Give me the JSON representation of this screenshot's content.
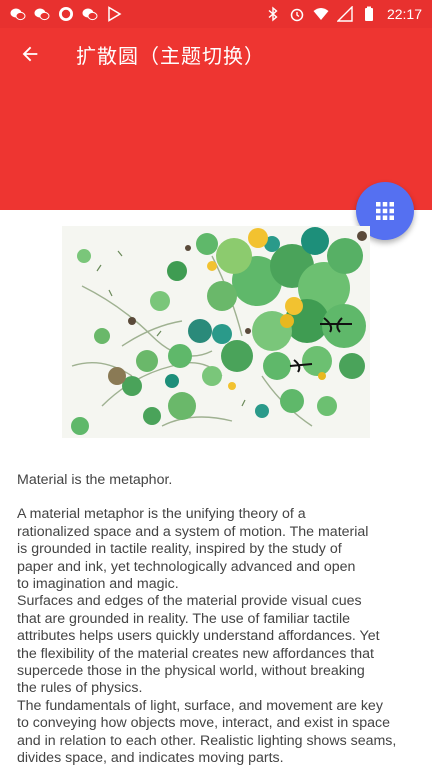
{
  "status_bar": {
    "left_icons": [
      "wechat-icon",
      "wechat-icon",
      "record-icon",
      "wechat-icon",
      "play-store-icon"
    ],
    "right_icons": [
      "bluetooth-icon",
      "alarm-icon",
      "wifi-icon",
      "signal-icon",
      "battery-icon"
    ],
    "time": "22:17"
  },
  "app_bar": {
    "title": "扩散圆（主题切换）",
    "back_icon": "arrow-back-icon",
    "color": "#ee3531"
  },
  "fab": {
    "icon": "grid-icon",
    "color": "#5570f1"
  },
  "article": {
    "heading": "Material is the metaphor.",
    "body": " A material metaphor is the unifying theory of a\nrationalized space and a system of motion. The material\nis grounded in tactile reality, inspired by the study of\npaper and ink, yet  technologically advanced and open\nto imagination and magic.\n Surfaces and edges of the material provide visual cues\nthat are grounded in reality. The  use of familiar tactile\nattributes helps users quickly understand affordances. Yet\nthe  flexibility of the material creates new affordances that\nsupercede those in the physical  world, without breaking\nthe rules of physics.\n The fundamentals of light, surface, and movement are key\nto conveying how objects move,  interact, and exist in space\nand in relation to each other. Realistic lighting shows  seams,\ndivides space, and indicates moving parts."
  }
}
